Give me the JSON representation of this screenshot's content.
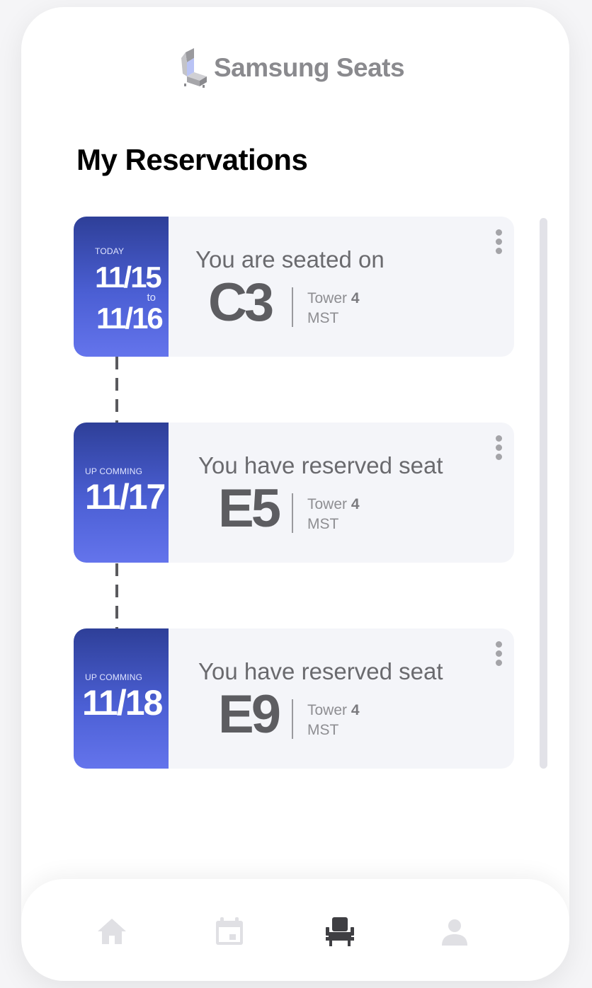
{
  "app": {
    "name": "Samsung Seats"
  },
  "page": {
    "title": "My Reservations"
  },
  "reservations": [
    {
      "status": "TODAY",
      "date_from": "11/15",
      "date_connector": "to",
      "date_to": "11/16",
      "message": "You are seated on",
      "seat": "C3",
      "tower_label": "Tower",
      "tower_number": "4",
      "timezone": "MST"
    },
    {
      "status": "UP COMMING",
      "date": "11/17",
      "message": "You have reserved seat",
      "seat": "E5",
      "tower_label": "Tower",
      "tower_number": "4",
      "timezone": "MST"
    },
    {
      "status": "UP COMMING",
      "date": "11/18",
      "message": "You have reserved seat",
      "seat": "E9",
      "tower_label": "Tower",
      "tower_number": "4",
      "timezone": "MST"
    }
  ],
  "nav": {
    "items": [
      {
        "icon": "home-icon",
        "active": false
      },
      {
        "icon": "calendar-icon",
        "active": false
      },
      {
        "icon": "seat-icon",
        "active": true
      },
      {
        "icon": "user-icon",
        "active": false
      }
    ],
    "active_color": "#3f3f43",
    "inactive_color": "#e0e0e4"
  },
  "colors": {
    "accent_top": "#2e3f98",
    "accent_bottom": "#6474ec"
  }
}
